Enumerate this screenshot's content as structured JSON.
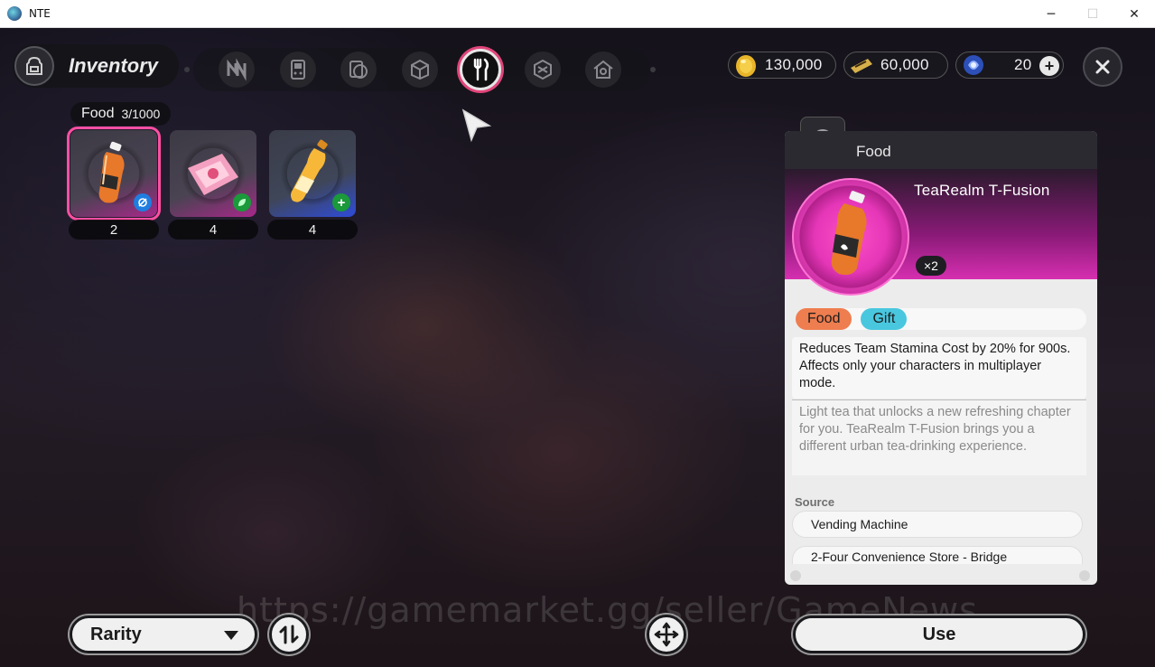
{
  "window": {
    "title": "NTE",
    "minimize": "─",
    "maximize": "☐",
    "close": "✕"
  },
  "header": {
    "title": "Inventory"
  },
  "tabs": [
    {
      "name": "special"
    },
    {
      "name": "gadgets"
    },
    {
      "name": "devices"
    },
    {
      "name": "materials"
    },
    {
      "name": "food",
      "active": true
    },
    {
      "name": "blueprints"
    },
    {
      "name": "housing"
    }
  ],
  "currency": [
    {
      "icon": "gold-coin-icon",
      "value": "130,000"
    },
    {
      "icon": "ticket-icon",
      "value": "60,000"
    },
    {
      "icon": "crystal-icon",
      "value": "20"
    }
  ],
  "category": {
    "name": "Food",
    "count": "3/1000"
  },
  "items": [
    {
      "name": "TeaRealm T-Fusion",
      "quantity": "2",
      "rarity": "purple",
      "badge": "swirl-badge-icon",
      "badge_color": "#1f7ee0",
      "selected": true
    },
    {
      "name": "Pink snack",
      "quantity": "4",
      "rarity": "purple",
      "badge": "leaf-badge-icon",
      "badge_color": "#1a9a3a",
      "selected": false
    },
    {
      "name": "Orange drink",
      "quantity": "4",
      "rarity": "blue",
      "badge": "plus-badge-icon",
      "badge_color": "#1a9a3a",
      "selected": false
    }
  ],
  "detail": {
    "category": "Food",
    "name": "TeaRealm T-Fusion",
    "count": "×2",
    "tags": [
      "Food",
      "Gift"
    ],
    "effect": "Reduces Team Stamina Cost by 20% for 900s. Affects only your characters in multiplayer mode.",
    "description": "Light tea that unlocks a new refreshing chapter for you. TeaRealm T-Fusion brings you a different urban tea-drinking experience.",
    "source_heading": "Source",
    "sources": [
      "Vending Machine",
      "2-Four Convenience Store - Bridge"
    ]
  },
  "footer": {
    "sort_label": "Rarity",
    "use_label": "Use"
  },
  "watermark": "https://gamemarket.gg/seller/GameNews",
  "colors": {
    "accent": "#e0457a",
    "rarity_purple": "#a8288a",
    "rarity_blue": "#2f4bd8",
    "tag_food": "#ee7d4f",
    "tag_gift": "#49c7df"
  }
}
